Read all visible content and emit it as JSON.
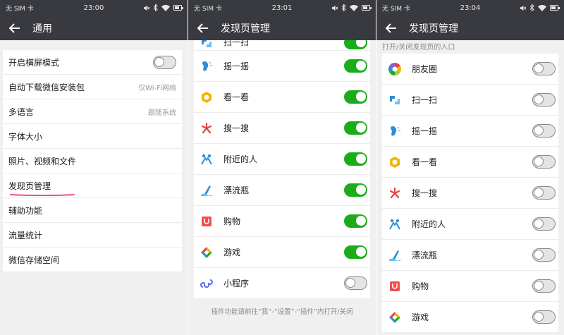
{
  "status": {
    "carrier": "无 SIM 卡",
    "times": [
      "23:00",
      "23:01",
      "23:04"
    ]
  },
  "screen1": {
    "title": "通用",
    "items": [
      {
        "label": "开启横屏模式",
        "value": ""
      },
      {
        "label": "自动下载微信安装包",
        "value": "仅Wi-Fi网络"
      },
      {
        "label": "多语言",
        "value": "跟随系统"
      },
      {
        "label": "字体大小",
        "value": ""
      },
      {
        "label": "照片、视频和文件",
        "value": ""
      },
      {
        "label": "发现页管理",
        "value": ""
      },
      {
        "label": "辅助功能",
        "value": ""
      },
      {
        "label": "流量统计",
        "value": ""
      },
      {
        "label": "微信存储空间",
        "value": ""
      }
    ],
    "landscape_toggle": "off",
    "highlight_color": "#e8336d"
  },
  "screen2": {
    "title": "发现页管理",
    "items": [
      {
        "label": "扫一扫",
        "icon": "scan-icon",
        "state": "on"
      },
      {
        "label": "摇一摇",
        "icon": "shake-icon",
        "state": "on"
      },
      {
        "label": "看一看",
        "icon": "top-stories-icon",
        "state": "on"
      },
      {
        "label": "搜一搜",
        "icon": "search-icon",
        "state": "on"
      },
      {
        "label": "附近的人",
        "icon": "people-nearby-icon",
        "state": "on"
      },
      {
        "label": "漂流瓶",
        "icon": "drift-bottle-icon",
        "state": "on"
      },
      {
        "label": "购物",
        "icon": "shopping-icon",
        "state": "on"
      },
      {
        "label": "游戏",
        "icon": "games-icon",
        "state": "on"
      },
      {
        "label": "小程序",
        "icon": "mini-program-icon",
        "state": "off"
      }
    ],
    "footer": "插件功能请前往“我”-“设置”-“插件”内打开/关闭"
  },
  "screen3": {
    "title": "发现页管理",
    "section": "打开/关闭发现页的入口",
    "items": [
      {
        "label": "朋友圈",
        "icon": "moments-icon",
        "state": "off"
      },
      {
        "label": "扫一扫",
        "icon": "scan-icon",
        "state": "off"
      },
      {
        "label": "摇一摇",
        "icon": "shake-icon",
        "state": "off"
      },
      {
        "label": "看一看",
        "icon": "top-stories-icon",
        "state": "off"
      },
      {
        "label": "搜一搜",
        "icon": "search-icon",
        "state": "off"
      },
      {
        "label": "附近的人",
        "icon": "people-nearby-icon",
        "state": "off"
      },
      {
        "label": "漂流瓶",
        "icon": "drift-bottle-icon",
        "state": "off"
      },
      {
        "label": "购物",
        "icon": "shopping-icon",
        "state": "off"
      },
      {
        "label": "游戏",
        "icon": "games-icon",
        "state": "off"
      }
    ]
  },
  "colors": {
    "header": "#393a3f",
    "toggle_on": "#1aad19",
    "toggle_off_border": "#8a8a8a"
  }
}
